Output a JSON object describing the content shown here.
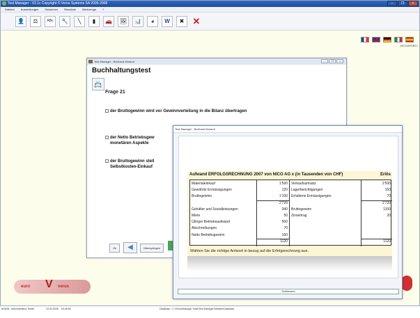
{
  "app": {
    "title": "Test Manager - V2.1c Copyright © Verus Systems SA 2005-2008",
    "menu": [
      "Dateien",
      "Auswertungen",
      "Sessionen",
      "Resultate",
      "Werkzeuge",
      "?"
    ],
    "toolbar_icons": [
      "users-icon",
      "scale-icon",
      "abc-icon",
      "wrench-icon",
      "tools-icon",
      "document-icon",
      "car-icon",
      "image-icon",
      "chart-icon",
      "pie-icon",
      "word-icon",
      "tools2-icon",
      "delete-icon"
    ],
    "window_buttons": [
      "–",
      "❐",
      "×"
    ],
    "languages": [
      "fr",
      "en",
      "de",
      "it",
      "es"
    ],
    "accounting_label": "ACCOUNTING I"
  },
  "bg_window": {
    "title": "Test Manager - Bertrand Morand",
    "heading": "Buchhaltungstest",
    "question_label": "Frage 21",
    "options": [
      "der Bruttogewinn wird vor Gewinnverteilung in die Bilanz übertragen",
      "der Netto Betriebsgew",
      "monetären Aspekte",
      "der Bruttogewinn stell",
      "Selbstkosten-Einkauf"
    ],
    "ok_label": "Ok",
    "skip_label": "Überspringen"
  },
  "fg_window": {
    "title": "Test Manager - Bertrand Morand",
    "table_title": "Aufwand ERFOLGSRECHNUNG 2007 von NICO AG x (in Tausenden von CHF)",
    "revenue_header": "Erlös",
    "left_rows": [
      {
        "label": "Materialeinkauf",
        "value": "1'500"
      },
      {
        "label": "Gewährte Ermässigungen",
        "value": "120"
      },
      {
        "label": "Bruttogewinn",
        "value": "1'100"
      },
      {
        "label": "",
        "value": "2'720"
      },
      {
        "label": "Gehälter und Sozialleistungen",
        "value": "340"
      },
      {
        "label": "Miete",
        "value": "50"
      },
      {
        "label": "Übriger Betriebsaufwand",
        "value": "500"
      },
      {
        "label": "Abschreibungen",
        "value": "70"
      },
      {
        "label": "Netto Betriebsgewinn",
        "value": "160"
      },
      {
        "label": "",
        "value": "1120"
      }
    ],
    "right_rows": [
      {
        "label": "Verkaufsumsatz",
        "value": "2'500"
      },
      {
        "label": "Lagerberichtigungen",
        "value": "150"
      },
      {
        "label": "Erhaltene Ermässigungen",
        "value": "70"
      },
      {
        "label": "",
        "value": "2'720"
      },
      {
        "label": "Bruttogewinn",
        "value": "1100"
      },
      {
        "label": "Zinsertrag",
        "value": "20"
      },
      {
        "label": "",
        "value": ""
      },
      {
        "label": "",
        "value": ""
      },
      {
        "label": "",
        "value": ""
      },
      {
        "label": "",
        "value": "1120"
      }
    ],
    "instruction": "Wählen Sie die richtige Antwort in bezug auf die Erfolgsrechnung aus.",
    "close_label": "Schliessen"
  },
  "logo": {
    "left": "euro",
    "right": "verus"
  },
  "status": {
    "user": "ADMIN : Administrateur TestM",
    "date": "19.03.2008",
    "time": "09:46:55",
    "database": "DataBase : C:\\Verus\\Manager Suite\\Test Manager2\\Master\\Database"
  }
}
